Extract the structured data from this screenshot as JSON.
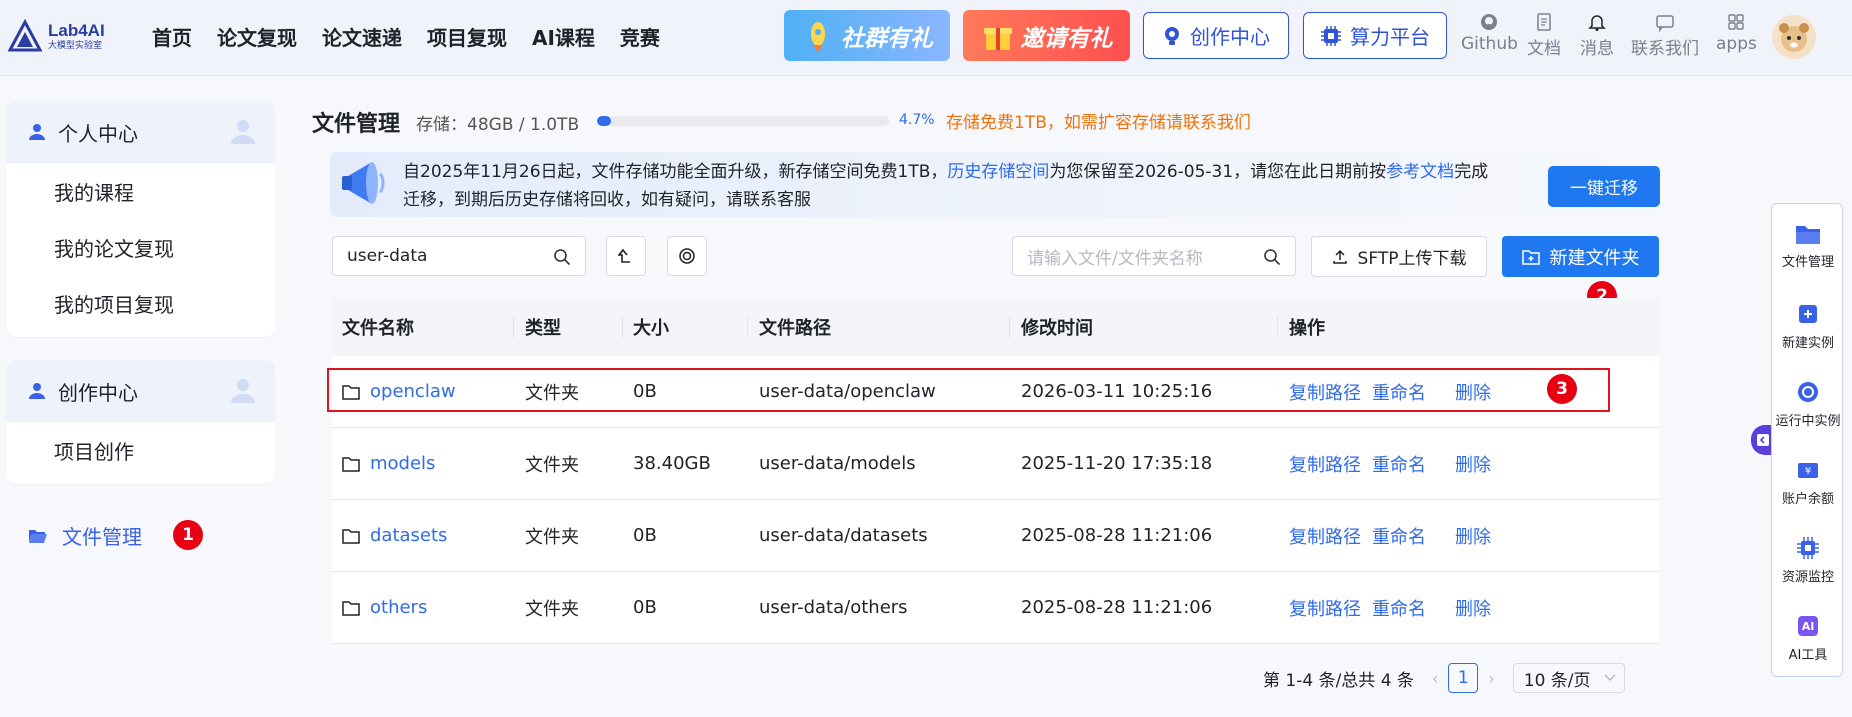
{
  "header": {
    "logo_name": "Lab4AI",
    "logo_sub": "大模型实验室",
    "nav": [
      "首页",
      "论文复现",
      "论文速递",
      "项目复现",
      "AI课程",
      "竞赛"
    ],
    "promo_community": "社群有礼",
    "promo_invite": "邀请有礼",
    "creator_center": "创作中心",
    "compute_platform": "算力平台",
    "icons": [
      {
        "label": "Github",
        "icon": "github-icon"
      },
      {
        "label": "文档",
        "icon": "document-icon"
      },
      {
        "label": "消息",
        "icon": "bell-icon"
      },
      {
        "label": "联系我们",
        "icon": "contact-icon"
      },
      {
        "label": "apps",
        "icon": "apps-icon"
      }
    ]
  },
  "sidebar": {
    "personal_center": {
      "title": "个人中心",
      "items": [
        "我的课程",
        "我的论文复现",
        "我的项目复现"
      ]
    },
    "creator_center": {
      "title": "创作中心",
      "items": [
        "项目创作"
      ]
    },
    "active_item": "文件管理"
  },
  "main": {
    "title": "文件管理",
    "storage_label": "存储：48GB / 1.0TB",
    "storage_percent": "4.7%",
    "storage_fraction": 0.047,
    "free_note": "存储免费1TB，如需扩容存储请联系我们",
    "notice": {
      "part1": "自2025年11月26日起，文件存储功能全面升级，新存储空间免费1TB，",
      "link1": "历史存储空间",
      "part2": "为您保留至2026-05-31，请您在此日期前按",
      "link2": "参考文档",
      "part3": "完成迁移，到期后历史存储将回收，如有疑问，请联系客服"
    },
    "migrate_button": "一键迁移",
    "path_value": "user-data",
    "search_placeholder": "请输入文件/文件夹名称",
    "sftp_button": "SFTP上传下载",
    "new_folder_button": "新建文件夹",
    "table": {
      "columns": [
        "文件名称",
        "类型",
        "大小",
        "文件路径",
        "修改时间",
        "操作"
      ],
      "rows": [
        {
          "name": "openclaw",
          "type": "文件夹",
          "size": "0B",
          "path": "user-data/openclaw",
          "time": "2026-03-11 10:25:16"
        },
        {
          "name": "models",
          "type": "文件夹",
          "size": "38.40GB",
          "path": "user-data/models",
          "time": "2025-11-20 17:35:18"
        },
        {
          "name": "datasets",
          "type": "文件夹",
          "size": "0B",
          "path": "user-data/datasets",
          "time": "2025-08-28 11:21:06"
        },
        {
          "name": "others",
          "type": "文件夹",
          "size": "0B",
          "path": "user-data/others",
          "time": "2025-08-28 11:21:06"
        }
      ],
      "actions": [
        "复制路径",
        "重命名",
        "删除"
      ]
    },
    "pagination": {
      "summary": "第 1-4 条/总共 4 条",
      "prev": "‹",
      "current_page": "1",
      "next": "›",
      "page_size": "10 条/页"
    }
  },
  "annotations": {
    "badge_1": "1",
    "badge_2": "2",
    "badge_3": "3"
  },
  "right_panel": {
    "items": [
      "文件管理",
      "新建实例",
      "运行中实例",
      "账户余额",
      "资源监控",
      "AI工具"
    ]
  },
  "colors": {
    "accent": "#1f78f0",
    "link": "#2f6bea",
    "warning_text": "#f0720c",
    "annotation_red": "#e60012"
  }
}
